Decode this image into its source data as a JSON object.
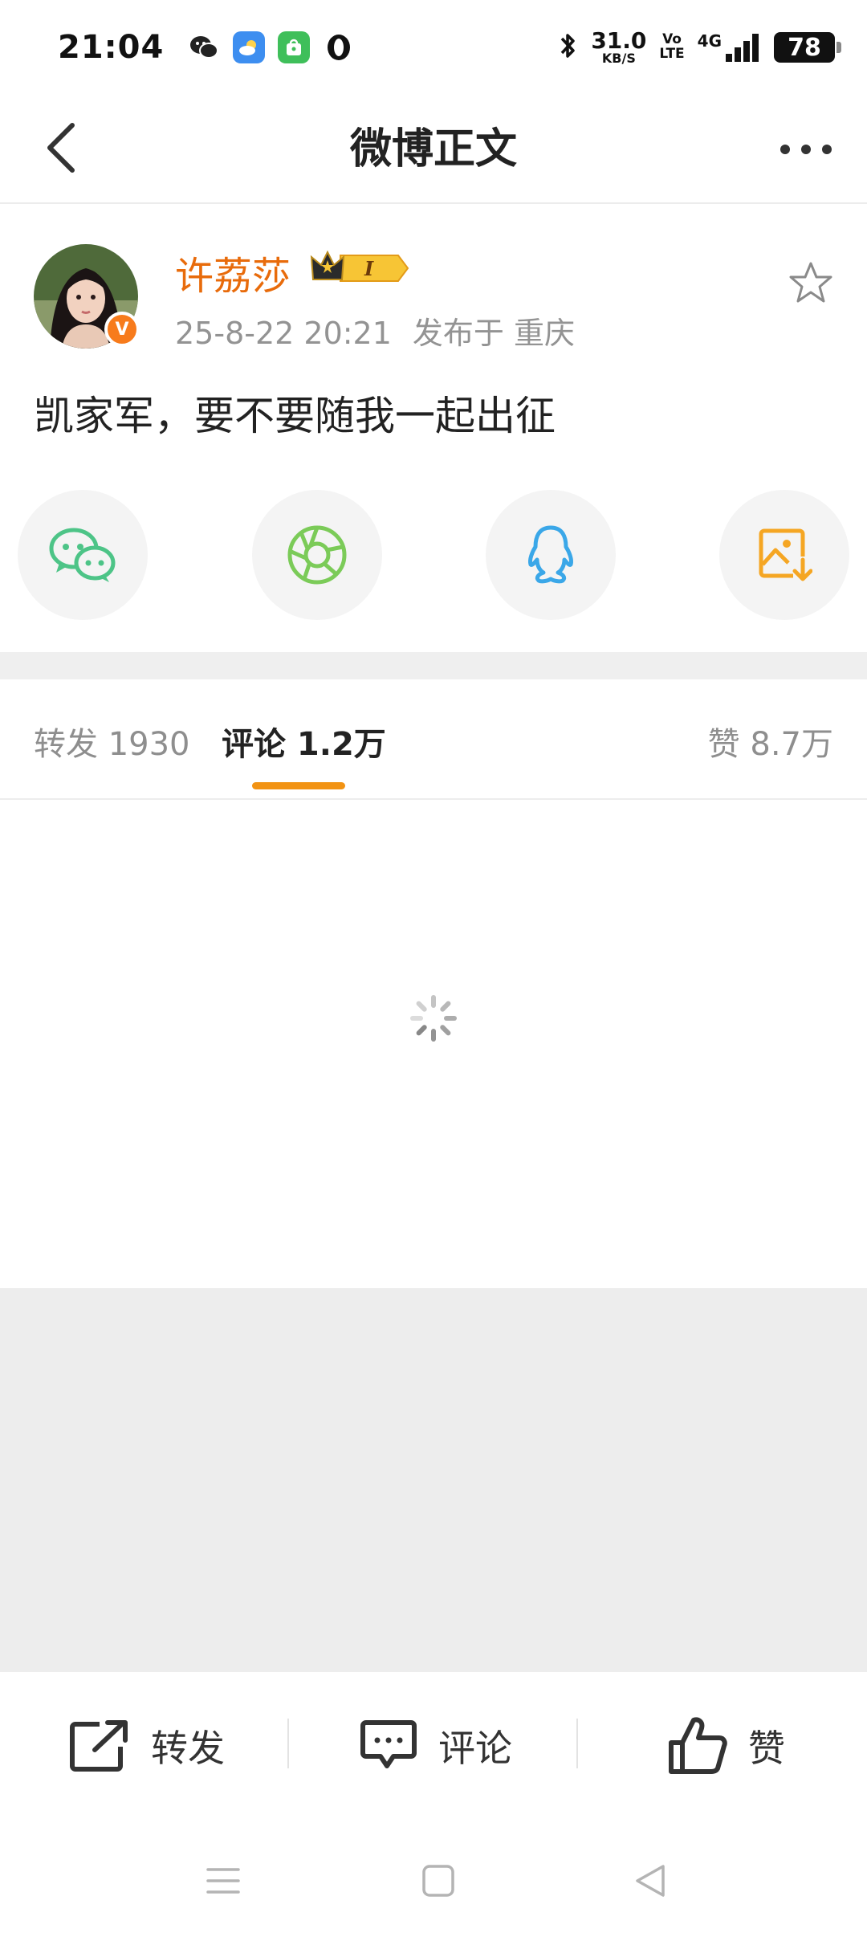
{
  "status_bar": {
    "time": "21:04",
    "net_speed_value": "31.0",
    "net_speed_unit": "KB/S",
    "volte_top": "Vo",
    "volte_bottom": "LTE",
    "network": "4G",
    "battery": "78"
  },
  "nav": {
    "title": "微博正文"
  },
  "post": {
    "user_name": "许荔莎",
    "verify_mark": "V",
    "vip_level": "I",
    "date": "25-8-22 20:21",
    "location": "发布于 重庆",
    "text": "凯家军，要不要随我一起出征"
  },
  "share": {
    "icons": [
      "wechat-icon",
      "moments-icon",
      "qq-icon",
      "save-image-icon"
    ]
  },
  "tabs": {
    "repost": "转发 1930",
    "comment": "评论 1.2万",
    "like": "赞 8.7万"
  },
  "actions": {
    "repost": "转发",
    "comment": "评论",
    "like": "赞"
  },
  "colors": {
    "accent": "#f29313",
    "username": "#e86b0b",
    "meta": "#939393",
    "background_gray": "#ededed"
  }
}
